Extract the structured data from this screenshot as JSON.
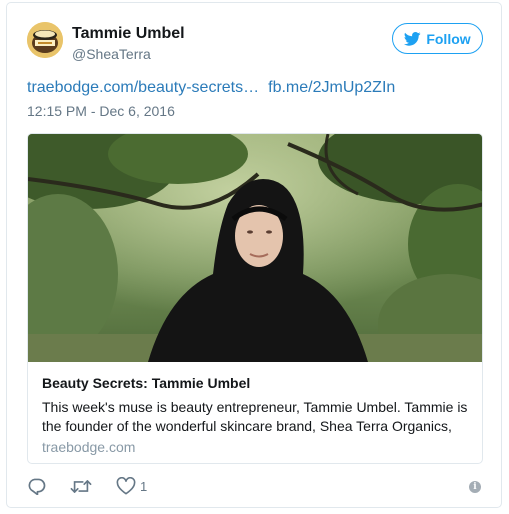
{
  "author": {
    "name": "Tammie Umbel",
    "handle": "@SheaTerra",
    "avatar_icon": "avatar-jar-image"
  },
  "follow_button": {
    "label": "Follow",
    "icon": "twitter-bird-icon",
    "color": "#1da1f2"
  },
  "tweet": {
    "link1": "traebodge.com/beauty-secrets…",
    "link2": "fb.me/2JmUp2ZIn",
    "timestamp": "12:15 PM - Dec 6, 2016",
    "link_color": "#2b7bb9"
  },
  "card": {
    "title": "Beauty Secrets: Tammie Umbel",
    "description": "This week's muse is beauty entrepreneur, Tammie Umbel. Tammie is the founder of the wonderful skincare brand, Shea Terra Organics,",
    "domain": "traebodge.com",
    "image_icon": "woman-under-tree-photo"
  },
  "actions": {
    "reply_icon": "reply-icon",
    "retweet_icon": "retweet-icon",
    "like_icon": "heart-icon",
    "like_count": "1",
    "info_icon": "info-icon",
    "info_glyph": "i"
  }
}
